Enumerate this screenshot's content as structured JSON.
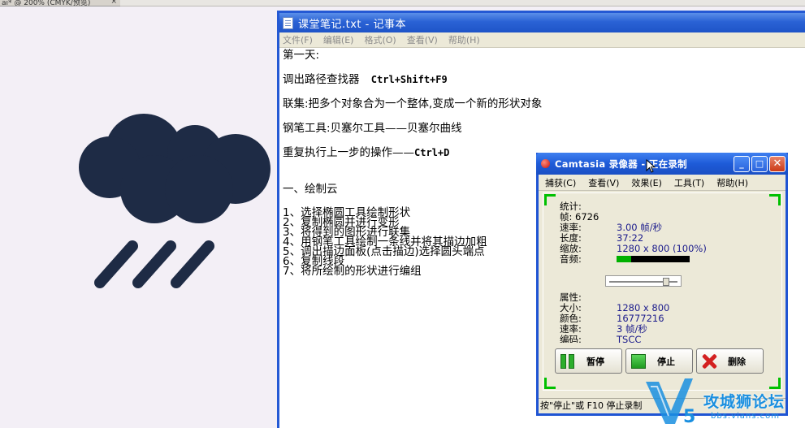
{
  "background_tab": {
    "label": "ai* @ 200% (CMYK/预览)",
    "close": "×"
  },
  "notepad": {
    "title": "课堂笔记.txt - 记事本",
    "menus": [
      "文件(F)",
      "编辑(E)",
      "格式(O)",
      "查看(V)",
      "帮助(H)"
    ],
    "lines": {
      "day": "第一天:",
      "path_finder_label": "调出路径查找器",
      "path_finder_shortcut": "Ctrl+Shift+F9",
      "union": "联集:把多个对象合为一个整体,变成一个新的形状对象",
      "pen": "钢笔工具:贝塞尔工具——贝塞尔曲线",
      "repeat_label": "重复执行上一步的操作——",
      "repeat_shortcut": "Ctrl+D",
      "section": "一、绘制云",
      "steps": [
        "1、选择椭圆工具绘制形状",
        "2、复制椭圆并进行变形",
        "3、将得到的图形进行联集",
        "4、用钢笔工具绘制一条线并将其描边加粗",
        "5、调出描边面板(点击描边)选择圆头端点",
        "6、复制线段",
        "7、将所绘制的形状进行编组"
      ]
    }
  },
  "camtasia": {
    "title": "Camtasia 录像器 - 正在录制",
    "window_buttons": {
      "minimize": "_",
      "maximize": "□",
      "close": "✕"
    },
    "menus": [
      "捕获(C)",
      "查看(V)",
      "效果(E)",
      "工具(T)",
      "帮助(H)"
    ],
    "stats_header": "统计:",
    "frames": "帧: 6726",
    "stats": [
      {
        "k": "速率:",
        "v": "3.00 帧/秒"
      },
      {
        "k": "长度:",
        "v": "37:22"
      },
      {
        "k": "缩放:",
        "v": "1280 x 800 (100%)"
      }
    ],
    "audio_label": "音频:",
    "audio_level": 0.2,
    "props_header": "属性:",
    "props": [
      {
        "k": "大小:",
        "v": "1280 x 800"
      },
      {
        "k": "颜色:",
        "v": "16777216"
      },
      {
        "k": "速率:",
        "v": "3 帧/秒"
      },
      {
        "k": "编码:",
        "v": "TSCC"
      }
    ],
    "actions": {
      "pause": "暂停",
      "stop": "停止",
      "delete": "删除"
    },
    "status": "按\"停止\"或 F10 停止录制"
  },
  "watermark": {
    "main": "攻城狮论坛",
    "sub": "bbs.vians.com"
  },
  "colors": {
    "cloud": "#1e2b45",
    "xp_blue": "#1f54d3",
    "recording_green": "#00c000"
  },
  "icons": [
    "notepad-icon",
    "record-icon",
    "pause-icon",
    "stop-icon",
    "delete-icon",
    "cursor-icon",
    "cloud-rain-illustration"
  ]
}
